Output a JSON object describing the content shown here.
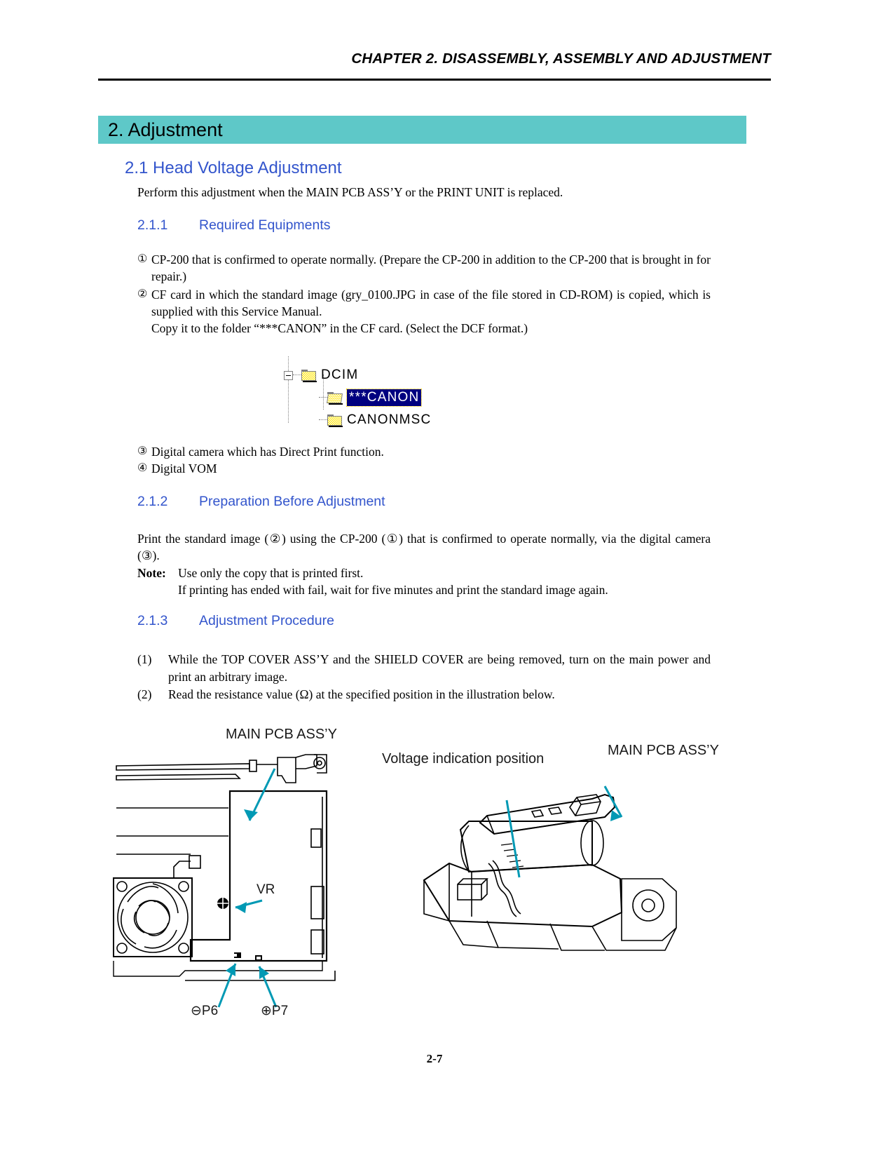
{
  "header": {
    "running_title": "CHAPTER 2.  DISASSEMBLY, ASSEMBLY AND ADJUSTMENT"
  },
  "banner": {
    "title": "2. Adjustment",
    "color": "#5ec8c8"
  },
  "section_2_1": {
    "heading": "2.1  Head Voltage Adjustment",
    "intro": "Perform this adjustment when the MAIN PCB ASS’Y or the PRINT UNIT is replaced."
  },
  "section_2_1_1": {
    "number": "2.1.1",
    "title": "Required Equipments",
    "items": [
      {
        "mark": "①",
        "text": "CP-200 that is confirmed to operate normally. (Prepare the CP-200 in addition to the CP-200 that is brought in for repair.)"
      },
      {
        "mark": "②",
        "text": "CF card in which the standard image (gry_0100.JPG in case of the file stored in CD-ROM) is copied, which is supplied with this Service Manual."
      },
      {
        "mark": "",
        "text": "Copy it to the folder “***CANON” in the CF card. (Select the DCF format.)"
      },
      {
        "mark": "③",
        "text": "Digital camera which has Direct Print function."
      },
      {
        "mark": "④",
        "text": "Digital VOM"
      }
    ]
  },
  "folder_tree": {
    "nodes": [
      {
        "label": "DCIM",
        "selected": false,
        "expander": "minus",
        "level": 0
      },
      {
        "label": "***CANON",
        "selected": true,
        "expander": "none",
        "level": 1
      },
      {
        "label": "CANONMSC",
        "selected": false,
        "expander": "none",
        "level": 1
      }
    ],
    "selection_bg": "#000080",
    "selection_fg": "#ffffff",
    "folder_color": "#ffe400"
  },
  "section_2_1_2": {
    "number": "2.1.2",
    "title": "Preparation Before Adjustment",
    "paragraph": "Print the standard image (②) using the CP-200 (①) that is confirmed to operate normally, via the digital camera (③).",
    "note_label": "Note:",
    "note_line_1": "Use only the copy that is printed first.",
    "note_line_2": "If printing has ended with fail, wait for five minutes and print the standard image again."
  },
  "section_2_1_3": {
    "number": "2.1.3",
    "title": "Adjustment Procedure",
    "steps": [
      {
        "mark": "(1)",
        "text": "While the TOP COVER ASS’Y and the SHIELD COVER are being removed, turn on the main power and print an arbitrary image."
      },
      {
        "mark": "(2)",
        "text": "Read the resistance value (Ω) at the specified position in the illustration below."
      }
    ]
  },
  "figure_left": {
    "name": "main-pcb-top-view",
    "labels": {
      "main_pcb": "MAIN PCB ASS’Y",
      "vr": "VR",
      "p6": "P6",
      "p7": "P7",
      "p6_symbol": "⊖",
      "p7_symbol": "⊕"
    },
    "arrow_color": "#0099b4"
  },
  "figure_right": {
    "name": "main-pcb-perspective-view",
    "labels": {
      "voltage_position": "Voltage indication position",
      "main_pcb": "MAIN PCB ASS’Y"
    },
    "arrow_color": "#0099b4"
  },
  "footer": {
    "page_number": "2-7"
  }
}
